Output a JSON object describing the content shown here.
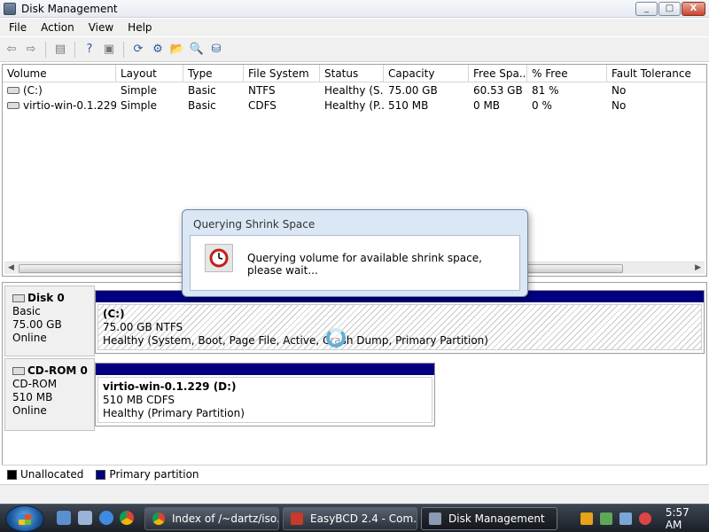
{
  "window": {
    "title": "Disk Management",
    "minimize": "_",
    "maximize": "□",
    "close": "X"
  },
  "menu": [
    "File",
    "Action",
    "View",
    "Help"
  ],
  "toolbar": {
    "buttons": [
      "back-icon",
      "forward-icon",
      "properties-icon",
      "help-icon",
      "console-icon",
      "refresh-icon",
      "settings-icon",
      "open-icon",
      "search-icon",
      "disk-icon"
    ],
    "glyphs": {
      "back": "⇦",
      "forward": "⇨",
      "properties": "▤",
      "help": "?",
      "console": "▣",
      "refresh": "⟳",
      "settings": "⚙",
      "open": "📂",
      "search": "🔍",
      "disk": "⛁"
    }
  },
  "volumes": {
    "columns": [
      "Volume",
      "Layout",
      "Type",
      "File System",
      "Status",
      "Capacity",
      "Free Spa...",
      "% Free",
      "Fault Tolerance"
    ],
    "rows": [
      {
        "volume": "(C:)",
        "layout": "Simple",
        "type": "Basic",
        "fs": "NTFS",
        "status": "Healthy (S...",
        "capacity": "75.00 GB",
        "free": "60.53 GB",
        "pct": "81 %",
        "fault": "No"
      },
      {
        "volume": "virtio-win-0.1.229 ...",
        "layout": "Simple",
        "type": "Basic",
        "fs": "CDFS",
        "status": "Healthy (P...",
        "capacity": "510 MB",
        "free": "0 MB",
        "pct": "0 %",
        "fault": "No"
      }
    ]
  },
  "disks": [
    {
      "name": "Disk 0",
      "type": "Basic",
      "size": "75.00 GB",
      "state": "Online",
      "partition": {
        "name": "(C:)",
        "size": "75.00 GB NTFS",
        "status": "Healthy (System, Boot, Page File, Active, Crash Dump, Primary Partition)"
      }
    },
    {
      "name": "CD-ROM 0",
      "type": "CD-ROM",
      "size": "510 MB",
      "state": "Online",
      "partition": {
        "name": "virtio-win-0.1.229  (D:)",
        "size": "510 MB CDFS",
        "status": "Healthy (Primary Partition)"
      }
    }
  ],
  "legend": {
    "unallocated": "Unallocated",
    "primary": "Primary partition",
    "unallocated_color": "#000000",
    "primary_color": "#000080"
  },
  "dialog": {
    "title": "Querying Shrink Space",
    "message": "Querying volume for available shrink space, please wait...",
    "icon": "clock-icon"
  },
  "taskbar": {
    "tasks": [
      {
        "label": "Index of /~dartz/iso...",
        "icon": "chrome-icon"
      },
      {
        "label": "EasyBCD 2.4 - Com...",
        "icon": "easybcd-icon"
      },
      {
        "label": "Disk Management",
        "icon": "disk-management-icon"
      }
    ],
    "clock": "5:57 AM"
  }
}
